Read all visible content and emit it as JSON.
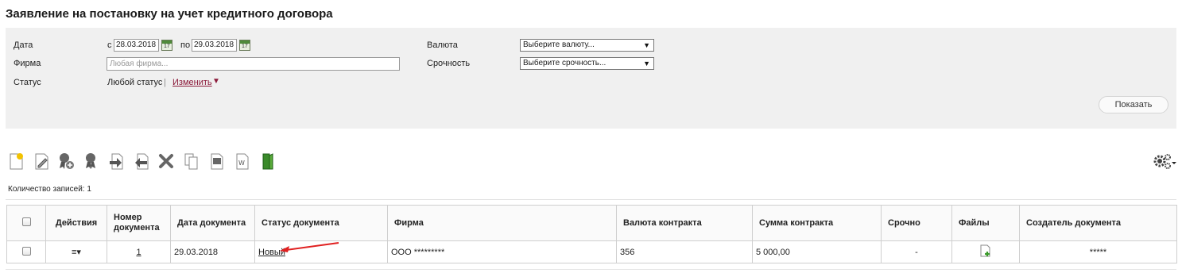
{
  "title": "Заявление на постановку на учет кредитного договора",
  "filters": {
    "date_label": "Дата",
    "date_from_prefix": "с",
    "date_from": "28.03.2018",
    "date_to_prefix": "по",
    "date_to": "29.03.2018",
    "calendar_glyph": "17",
    "firm_label": "Фирма",
    "firm_placeholder": "Любая фирма...",
    "status_label": "Статус",
    "status_value": "Любой статус",
    "status_separator": "|",
    "status_change": "Изменить",
    "currency_label": "Валюта",
    "currency_select": "Выберите валюту...",
    "urgency_label": "Срочность",
    "urgency_select": "Выберите срочность...",
    "show_button": "Показать"
  },
  "toolbar": {
    "icons": [
      "new-document-icon",
      "edit-document-icon",
      "add-signature-icon",
      "signature-icon",
      "send-icon",
      "receive-icon",
      "delete-icon",
      "copy-icon",
      "print-icon",
      "export-word-icon",
      "archive-icon",
      "settings-gear-icon"
    ]
  },
  "records_count": "Количество записей: 1",
  "table": {
    "headers": {
      "actions": "Действия",
      "doc_number": "Номер документа",
      "date": "Дата документа",
      "status": "Статус документа",
      "firm": "Фирма",
      "currency": "Валюта контракта",
      "amount": "Сумма контракта",
      "urgent": "Срочно",
      "files": "Файлы",
      "creator": "Создатель документа"
    },
    "rows": [
      {
        "actions_glyph": "≡▾",
        "doc_number": "1",
        "date": "29.03.2018",
        "status": "Новый",
        "firm": "ООО  *********",
        "currency": "356",
        "amount": "5 000,00",
        "urgent": "-",
        "creator": "*****"
      }
    ]
  },
  "colors": {
    "panel_bg": "#f0f0f0",
    "link_accent": "#8b1a3a",
    "annotation_arrow": "#e02020"
  }
}
